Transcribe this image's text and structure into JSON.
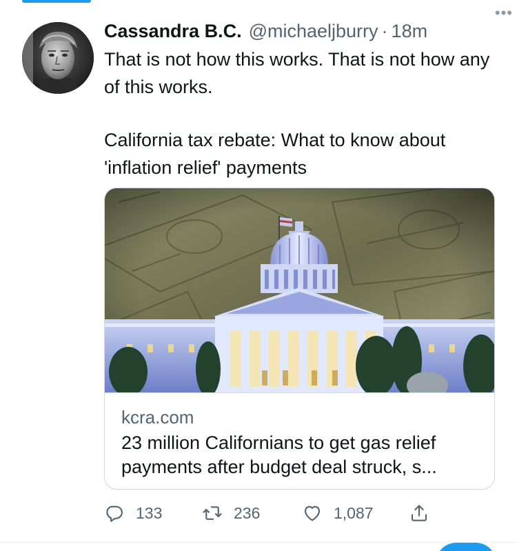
{
  "tweet": {
    "author": {
      "display_name": "Cassandra B.C.",
      "handle": "@michaeljburry",
      "separator": "·",
      "time": "18m"
    },
    "text_lines": [
      "That is not how this works. That is not how any of this works.",
      "California tax rebate: What to know about 'inflation relief' payments"
    ],
    "card": {
      "image_icon": "capitol-building-over-dollar-bills-image",
      "domain": "kcra.com",
      "title": "23 million Californians to get gas relief payments after budget deal struck, s..."
    },
    "actions": {
      "replies": "133",
      "retweets": "236",
      "likes": "1,087"
    }
  },
  "icons": {
    "more": "more-horizontal-icon",
    "reply": "reply-icon",
    "retweet": "retweet-icon",
    "like": "heart-icon",
    "share": "share-icon"
  },
  "colors": {
    "accent": "#1d9bf0",
    "secondary_text": "#536471",
    "primary_text": "#0f1419",
    "border": "#cfd9de"
  }
}
